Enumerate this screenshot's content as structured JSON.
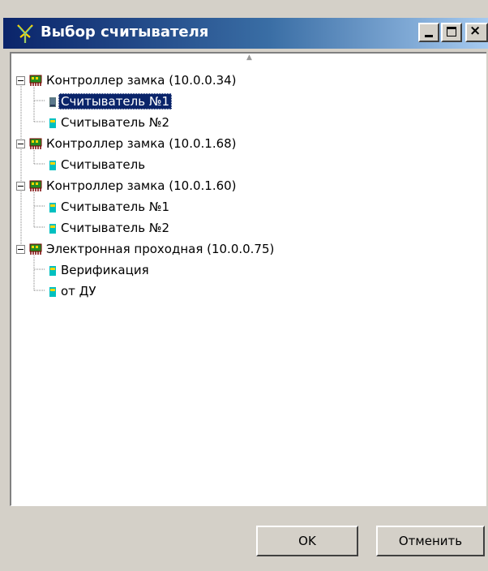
{
  "window": {
    "title": "Выбор считывателя",
    "colors": {
      "title_start": "#0a246a",
      "title_end": "#a6caf0",
      "selection": "#0a246a"
    }
  },
  "tree": {
    "nodes": [
      {
        "label": "Контроллер замка (10.0.0.34)",
        "icon": "controller-icon",
        "children": [
          {
            "label": "Считыватель №1",
            "icon": "reader-icon",
            "selected": true
          },
          {
            "label": "Считыватель №2",
            "icon": "reader-icon"
          }
        ]
      },
      {
        "label": "Контроллер замка (10.0.1.68)",
        "icon": "controller-icon",
        "children": [
          {
            "label": "Считыватель",
            "icon": "reader-icon"
          }
        ]
      },
      {
        "label": "Контроллер замка (10.0.1.60)",
        "icon": "controller-icon",
        "children": [
          {
            "label": "Считыватель №1",
            "icon": "reader-icon"
          },
          {
            "label": "Считыватель №2",
            "icon": "reader-icon"
          }
        ]
      },
      {
        "label": "Электронная проходная (10.0.0.75)",
        "icon": "controller-icon",
        "children": [
          {
            "label": "Верификация",
            "icon": "reader-icon"
          },
          {
            "label": "от ДУ",
            "icon": "reader-icon"
          }
        ]
      }
    ]
  },
  "buttons": {
    "ok": "OK",
    "cancel": "Отменить"
  }
}
